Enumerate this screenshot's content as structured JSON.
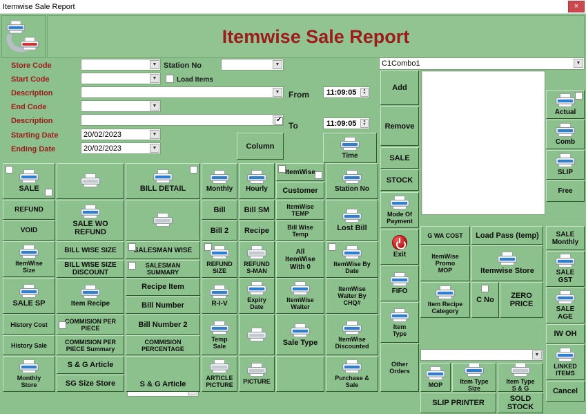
{
  "window": {
    "title": "Itemwise Sale Report",
    "close_label": "×"
  },
  "header": {
    "title": "Itemwise Sale Report",
    "logo_icon": "printer-pair-icon"
  },
  "form": {
    "fields": [
      {
        "label": "Store Code",
        "value": ""
      },
      {
        "label": "Start Code",
        "value": ""
      },
      {
        "label": "Description",
        "value": ""
      },
      {
        "label": "End Code",
        "value": ""
      },
      {
        "label": "Description",
        "value": ""
      },
      {
        "label": "Starting Date",
        "value": "20/02/2023"
      },
      {
        "label": "Ending Date",
        "value": "20/02/2023"
      }
    ],
    "station_no_label": "Station No",
    "station_no_value": "",
    "load_items_label": "Load Items",
    "load_items_checked": false,
    "from_label": "From",
    "from_value": "11:09:05",
    "to_label": "To",
    "to_value": "11:09:05",
    "to_checked": true,
    "column_button": "Column",
    "time_button": "Time"
  },
  "combo_panel": {
    "combo_value": "C1Combo1",
    "add_label": "Add",
    "remove_label": "Remove",
    "sale_label": "SALE",
    "stock_label": "STOCK",
    "list_items": []
  },
  "side_buttons": {
    "mode_of_payment": "Mode Of\nPayment",
    "exit": "Exit",
    "fifo": "FIFO",
    "item_type": "Item\nType",
    "other_orders": "Other\nOrders"
  },
  "far_right": {
    "actual": "Actual",
    "comb": "Comb",
    "slip": "SLIP",
    "free": "Free",
    "sale_monthly": "SALE\nMonthly",
    "sale_gst": "SALE\nGST",
    "sale_age": "SALE\nAGE",
    "iw_oh": "IW OH",
    "linked_items": "LINKED\nITEMS",
    "cancel": "Cancel"
  },
  "buttons": {
    "sale": "SALE",
    "refund": "REFUND",
    "void": "VOID",
    "itemwise_size": "ItemWise\nSize",
    "sale_sp": "SALE SP",
    "history_cost": "History Cost",
    "history_sale": "History Sale",
    "monthly_store": "Monthly\nStore",
    "blank_printer_1": "",
    "sale_wo_refund": "SALE WO\nREFUND",
    "bill_wise_size": "BILL WISE SIZE",
    "bill_wise_size_discount": "BILL WISE SIZE\nDISCOUNT",
    "item_recipe": "Item Recipe",
    "commision_per_piece": "COMMISION PER\nPIECE",
    "commision_per_piece_summary": "COMMISION PER\nPIECE Summary",
    "sg_article_1": "S & G Article",
    "sg_size_store": "SG Size Store",
    "bill_detail": "BILL DETAIL",
    "blank_printer_2": "",
    "salesman_wise": "SALESMAN WISE",
    "salesman_summary": "SALESMAN\nSUMMARY",
    "recipe_item": "Recipe Item",
    "bill_number": "Bill  Number",
    "bill_number_2": "Bill Number 2",
    "commision_percentage": "COMMISION\nPERCENTAGE",
    "sg_article_combo": "",
    "sg_article_2": "S & G Article",
    "monthly": "Monthly",
    "bill": "Bill",
    "bill_2": "Bill 2",
    "refund_size": "REFUND\nSIZE",
    "riv": "R-I-V",
    "temp_sale": "Temp\nSale",
    "article_picture": "ARTICLE\nPICTURE",
    "hourly": "Hourly",
    "bill_sm": "Bill SM",
    "recipe": "Recipe",
    "refund_sman": "REFUND\nS-MAN",
    "expiry_date": "Expiry\nDate",
    "blank_printer_3": "",
    "picture": "PICTURE",
    "itemwise": "ItemWise",
    "customer": "Customer",
    "itemwise_temp": "ItemWise\nTEMP",
    "bill_wise_temp": "Bill Wise\nTemp",
    "all_itemwise_with_0": "All\nItemWise\nWith 0",
    "itemwise_waiter": "ItemWise\nWaiter",
    "sale_type": "Sale Type",
    "station_no_btn": "Station No",
    "lost_bill": "Lost  Bill",
    "itemwise_by_date": "ItemWise By\nDate",
    "itemwise_waiter_by_chq": "ItemWise\nWaiter By\nCHQ#",
    "itemwise_discounted": "ItemWise\nDiscounted",
    "purchase_sale": "Purchase &\nSale",
    "gwa_cost": "G WA COST",
    "itemwise_promo_mop": "ItemWise\nPromo\nMOP",
    "item_recipe_category": "Item Recipe\nCategory",
    "load_pass_temp": "Load Pass (temp)",
    "itemwise_store": "Itemwise Store",
    "c_no": "C No",
    "zero_price": "ZERO\nPRICE",
    "bottom_combo": "",
    "mop": "MOP",
    "item_type_size": "Item Type\nSize",
    "item_type_sg": "Item Type\nS & G",
    "slip_printer": "SLIP PRINTER",
    "sold_stock": "SOLD\nSTOCK"
  },
  "colors": {
    "surface": "#8cc08c",
    "title_red": "#9e1b1b",
    "label_red": "#9e1b1b",
    "button_face": "#8cc08c",
    "close_red": "#c9494f"
  }
}
